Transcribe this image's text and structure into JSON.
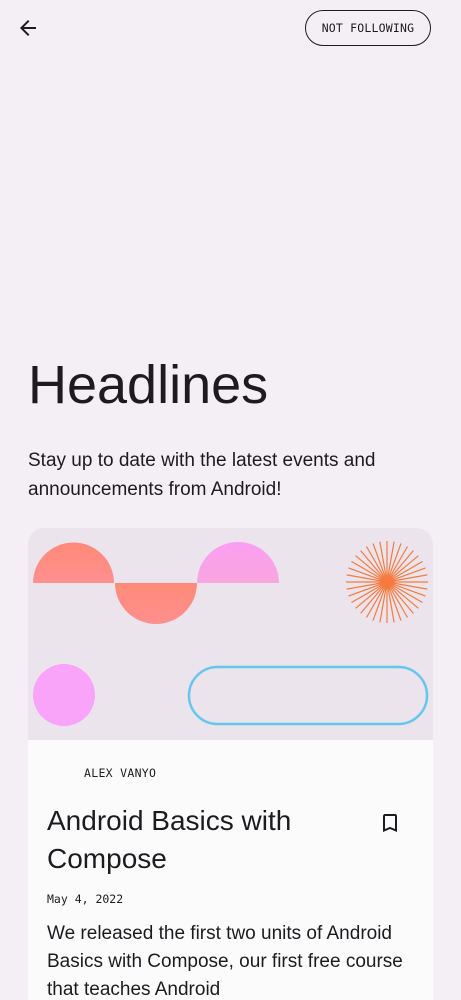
{
  "header": {
    "back_icon": "arrow-back-icon",
    "follow_label": "NOT FOLLOWING"
  },
  "topic": {
    "title": "Headlines",
    "description": "Stay up to date with the latest events and announcements from Android!"
  },
  "news_card": {
    "author": "ALEX VANYO",
    "title": "Android Basics with Compose",
    "date": "May 4, 2022",
    "description": "We released the first two units of Android Basics with Compose, our first free course that teaches Android",
    "bookmark_icon": "bookmark-outline-icon"
  },
  "colors": {
    "background": "#f4eff4",
    "coral": "#ff8a80",
    "pink": "#f9a3f5",
    "blue_outline": "#67c6ee",
    "orange_burst": "#f47a3e"
  }
}
